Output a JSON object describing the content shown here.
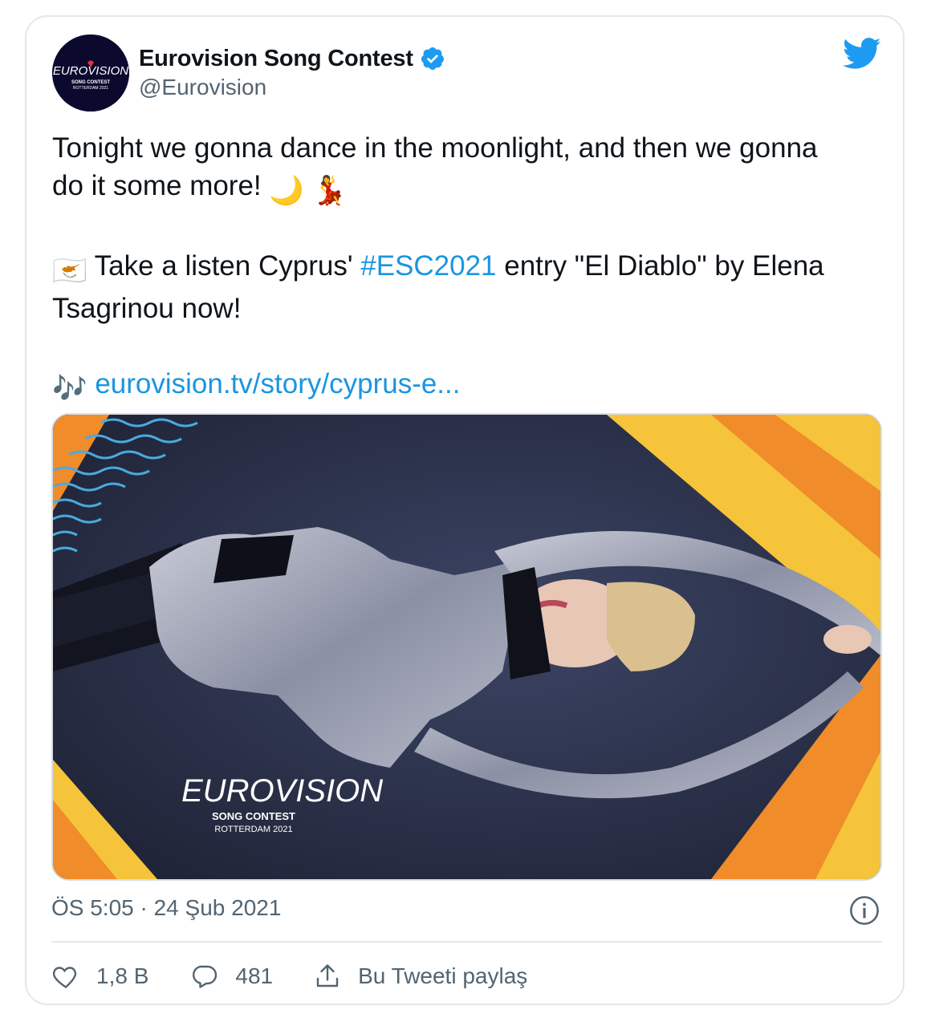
{
  "account": {
    "display_name": "Eurovision Song Contest",
    "handle": "@Eurovision",
    "verified": true,
    "avatar_logo": {
      "wordmark": "EUROVISION",
      "line1": "SONG CONTEST",
      "line2": "ROTTERDAM 2021"
    }
  },
  "tweet": {
    "line1": "Tonight we gonna dance in the moonlight, and then we gonna",
    "line2_text": "do it some more! ",
    "line2_emoji": "🌙 💃",
    "para2_flag_emoji": "🇨🇾",
    "para2_prefix": " Take a listen Cyprus' ",
    "hashtag": "#ESC2021",
    "para2_suffix": " entry \"El Diablo\" by Elena",
    "para2_line2": "Tsagrinou now!",
    "music_emoji": "🎶",
    "link_text": "eurovision.tv/story/cyprus-e..."
  },
  "media": {
    "logo_wordmark": "EUROVISION",
    "logo_line1": "SONG CONTEST",
    "logo_line2": "ROTTERDAM 2021"
  },
  "meta": {
    "timestamp": "ÖS 5:05 · 24 Şub 2021"
  },
  "actions": {
    "likes": "1,8 B",
    "replies": "481",
    "share_label": "Bu Tweeti paylaş"
  },
  "colors": {
    "brand_blue": "#1d9bf0",
    "link_blue": "#1b95e0",
    "muted_text": "#536471",
    "border": "#e1e8ed",
    "eurovision_orange": "#f08c2a",
    "eurovision_yellow": "#f5c43b"
  },
  "icons": {
    "logo": "twitter-bird-icon",
    "verified": "verified-badge-icon",
    "info": "info-icon",
    "like": "heart-icon",
    "reply": "reply-bubble-icon",
    "share": "share-icon"
  }
}
